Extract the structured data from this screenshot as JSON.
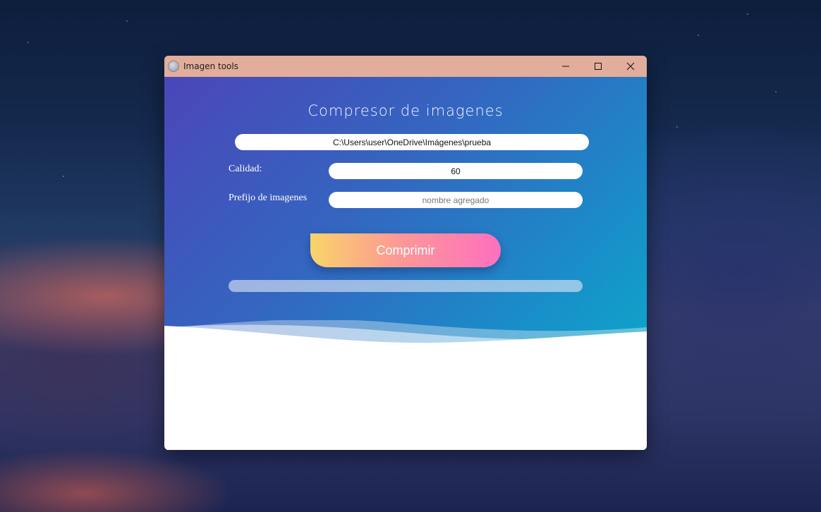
{
  "window": {
    "title": "Imagen tools"
  },
  "app": {
    "heading": "Compresor de imagenes",
    "folder_path": "C:\\Users\\user\\OneDrive\\Imágenes\\prueba",
    "quality_label": "Calidad:",
    "quality_value": "60",
    "prefix_label": "Prefijo de imagenes",
    "prefix_placeholder": "nombre agregado",
    "prefix_value": "",
    "compress_button": "Comprimir",
    "progress": 0
  },
  "icons": {
    "app": "globe-icon",
    "minimize": "minimize-icon",
    "maximize": "maximize-icon",
    "close": "close-icon"
  },
  "colors": {
    "titlebar": "#e3ad9b",
    "gradient_start": "#4b46b9",
    "gradient_end": "#08b3c9",
    "button_start": "#f9d468",
    "button_end": "#fe6fbf"
  }
}
